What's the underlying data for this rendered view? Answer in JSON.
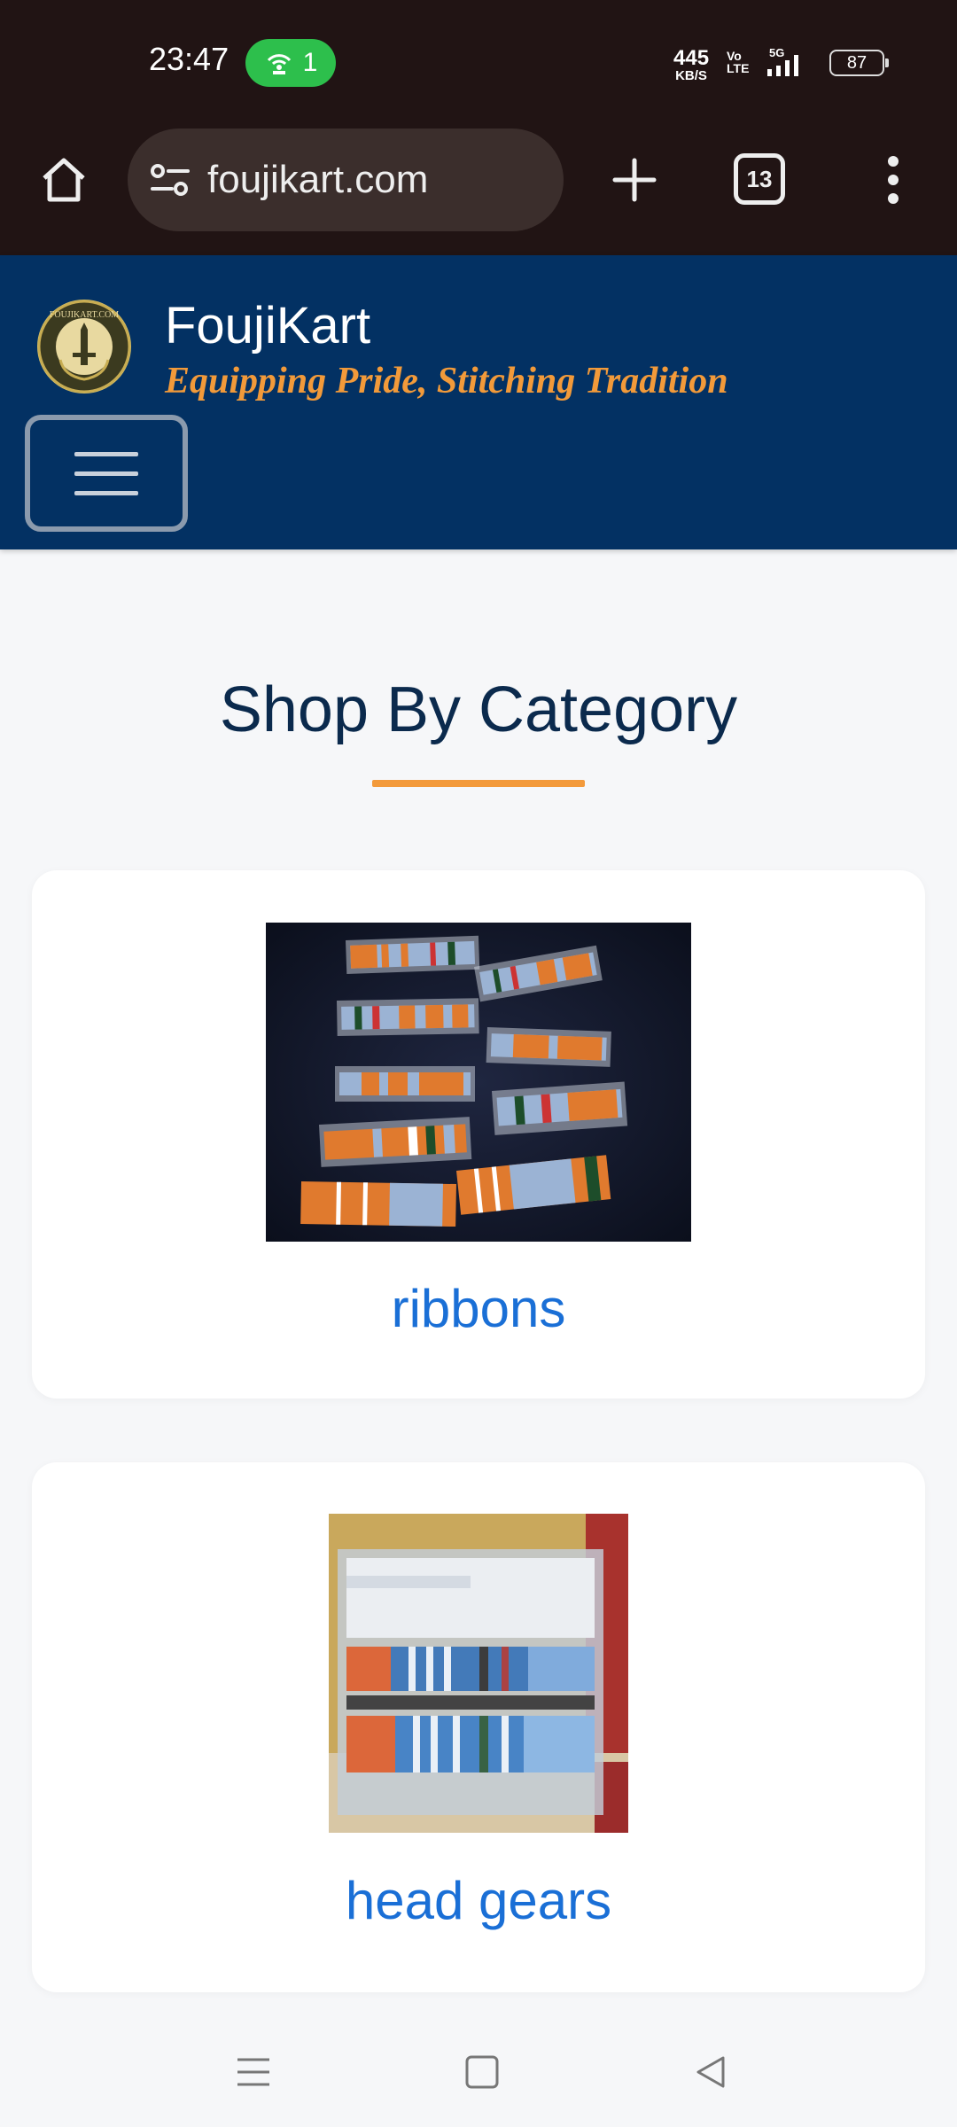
{
  "status_bar": {
    "time": "23:47",
    "hotspot_count": "1",
    "net_speed_value": "445",
    "net_speed_unit": "KB/S",
    "volte_top": "Vo",
    "volte_bottom": "LTE",
    "network": "5G",
    "battery": "87"
  },
  "browser": {
    "url": "foujikart.com",
    "tab_count": "13"
  },
  "site": {
    "brand_name": "FoujiKart",
    "tagline": "Equipping Pride, Stitching Tradition",
    "logo_text": "FOUJIKART.COM"
  },
  "section": {
    "title": "Shop By Category"
  },
  "categories": [
    {
      "label": "ribbons"
    },
    {
      "label": "head gears"
    }
  ],
  "colors": {
    "header_bg": "#033163",
    "accent_orange": "#f39a3b",
    "link_blue": "#1a6fd6",
    "chrome_bg": "#211414"
  }
}
